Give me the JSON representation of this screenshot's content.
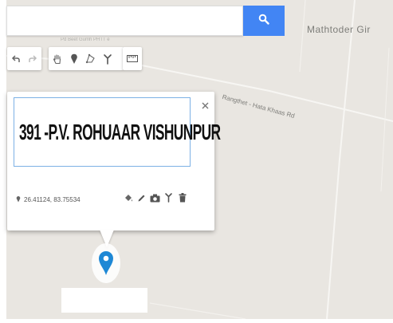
{
  "search": {
    "placeholder": "",
    "value": "",
    "button_icon": "search-icon"
  },
  "map": {
    "place_label": "Mathtoder Gir",
    "road_label": "Rangthet - Hata Khaas Rd",
    "faint_label": "Pd Beet Gumh PHTT e"
  },
  "toolbar": {
    "history": [
      "undo-icon",
      "redo-icon"
    ],
    "draw": [
      "hand-icon",
      "placemark-icon",
      "polygon-icon",
      "route-icon"
    ],
    "measure": [
      "ruler-icon"
    ]
  },
  "info_card": {
    "title": "391 -P.V. ROHUAAR VISHUNPUR",
    "coordinates": "26.41124, 83.75534",
    "actions": [
      "paint-bucket-icon",
      "pencil-icon",
      "camera-icon",
      "route-icon",
      "trash-icon"
    ],
    "close_icon": "close-icon"
  },
  "colors": {
    "accent": "#4285f4",
    "marker": "#1e88d5",
    "map_background": "#e9e6e1"
  }
}
